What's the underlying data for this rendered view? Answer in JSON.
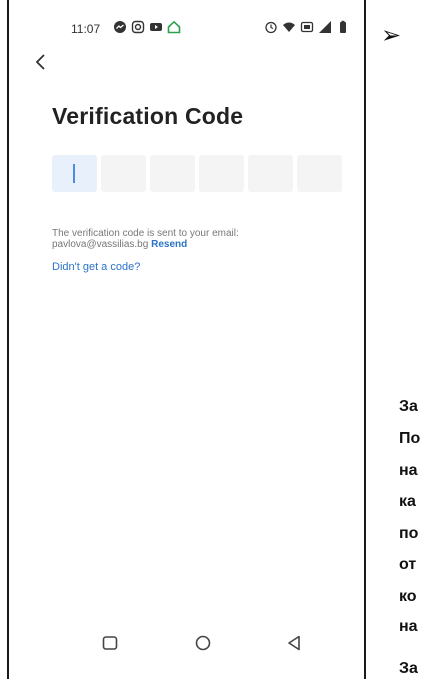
{
  "status_bar": {
    "time": "11:07"
  },
  "screen": {
    "title": "Verification Code",
    "code_length": 6,
    "sent_message": "The verification code is sent to your email:",
    "email": "pavlova@vassilias.bg",
    "resend_label": "Resend",
    "no_code_link": "Didn't get a code?"
  },
  "document": {
    "bullet": "➢",
    "fragments": [
      "За",
      "По",
      "на",
      "ка",
      "по",
      "от",
      "ко",
      "на",
      "За"
    ]
  },
  "colors": {
    "accent": "#2b73c8",
    "caret": "#4a8ce0",
    "box_active": "#e8f0fb",
    "box_inactive": "#f4f4f4"
  },
  "icons": {
    "back": "chevron-left-icon",
    "recents": "square-icon",
    "home": "circle-icon",
    "back_nav": "triangle-left-icon"
  }
}
